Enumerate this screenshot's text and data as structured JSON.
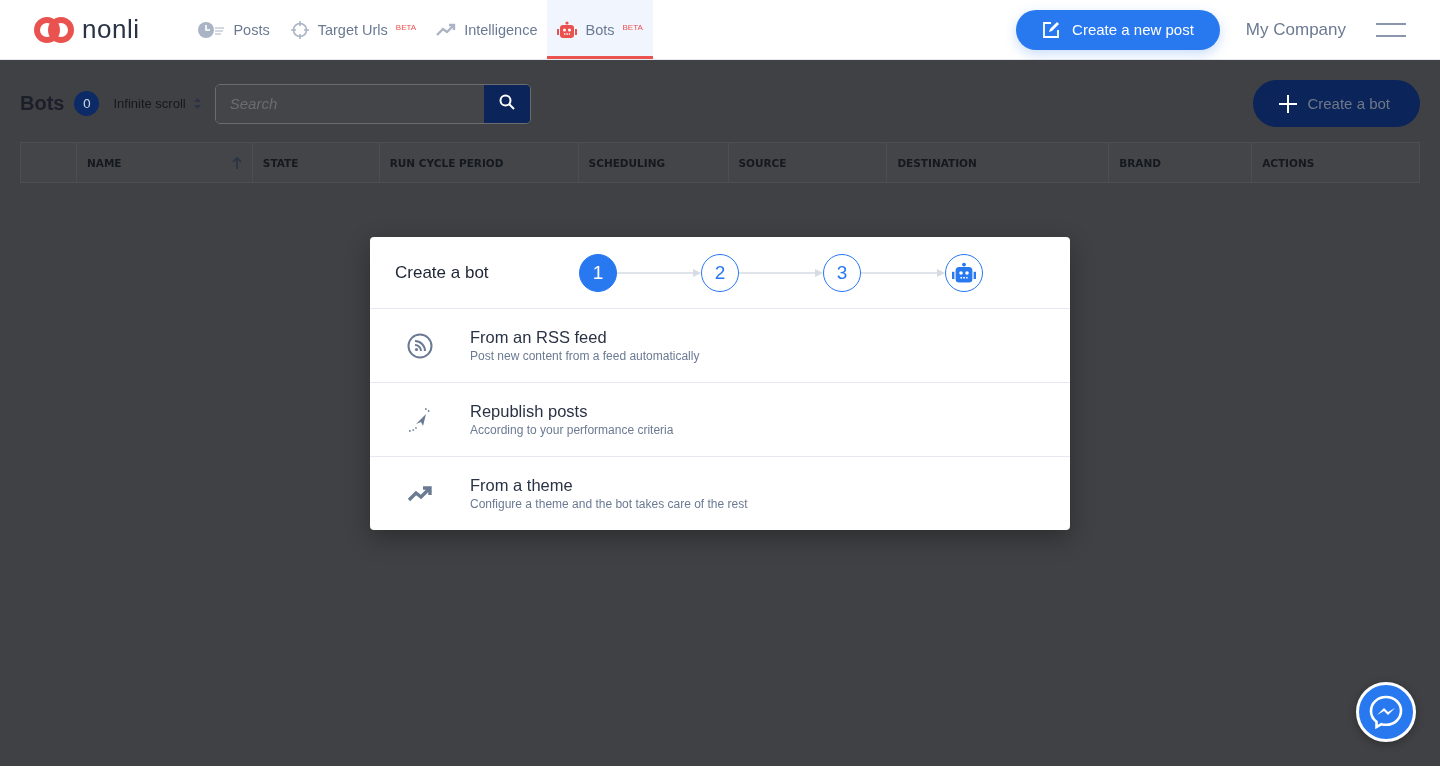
{
  "logo": {
    "name": "nonli"
  },
  "nav": [
    {
      "label": "Posts",
      "selected": false
    },
    {
      "label": "Target Urls",
      "badge": "BETA",
      "selected": false
    },
    {
      "label": "Intelligence",
      "selected": false
    },
    {
      "label": "Bots",
      "badge": "BETA",
      "selected": true
    }
  ],
  "header": {
    "new_post": "Create a new post",
    "company": "My Company"
  },
  "toolbar": {
    "title": "Bots",
    "count": "0",
    "mode": "Infinite scroll",
    "search": {
      "placeholder": "Search"
    },
    "create": "Create a bot"
  },
  "table": {
    "columns": [
      {
        "label": "NAME",
        "sorted": true
      },
      {
        "label": "STATE",
        "sorted": false
      },
      {
        "label": "RUN CYCLE PERIOD",
        "sorted": false
      },
      {
        "label": "SCHEDULING",
        "sorted": false
      },
      {
        "label": "SOURCE",
        "sorted": false
      },
      {
        "label": "DESTINATION",
        "sorted": false
      },
      {
        "label": "BRAND",
        "sorted": false
      },
      {
        "label": "ACTIONS",
        "sorted": false
      }
    ]
  },
  "modal": {
    "title": "Create a bot",
    "steps": [
      {
        "kind": "number",
        "label": "1",
        "selected": true
      },
      {
        "kind": "number",
        "label": "2",
        "selected": false
      },
      {
        "kind": "number",
        "label": "3",
        "selected": false
      },
      {
        "kind": "robot",
        "selected": false
      }
    ],
    "options": [
      {
        "title": "From an RSS feed",
        "subtitle": "Post new content from a feed automatically"
      },
      {
        "title": "Republish posts",
        "subtitle": "According to your performance criteria"
      },
      {
        "title": "From a theme",
        "subtitle": "Configure a theme and the bot takes care of the rest"
      }
    ]
  }
}
